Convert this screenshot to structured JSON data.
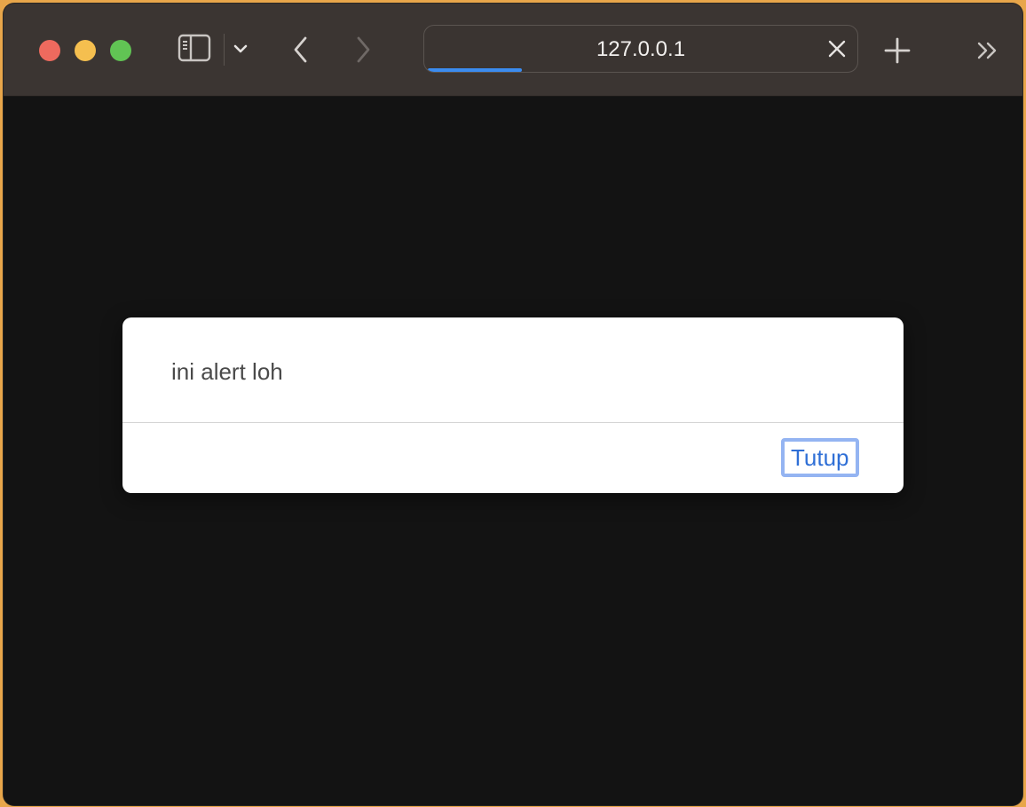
{
  "browser": {
    "url": "127.0.0.1",
    "load_progress": 0.22,
    "accent_color": "#3b8cf0",
    "icons": {
      "sidebar": "sidebar-icon",
      "tab_menu": "chevron-down-icon",
      "back": "back-arrow-icon",
      "forward": "forward-arrow-icon",
      "clear": "close-icon",
      "new_tab": "plus-icon",
      "more": "double-chevron-right-icon"
    }
  },
  "dialog": {
    "message": "ini alert loh",
    "button_label": "Tutup",
    "button_color": "#2f6fd6"
  }
}
